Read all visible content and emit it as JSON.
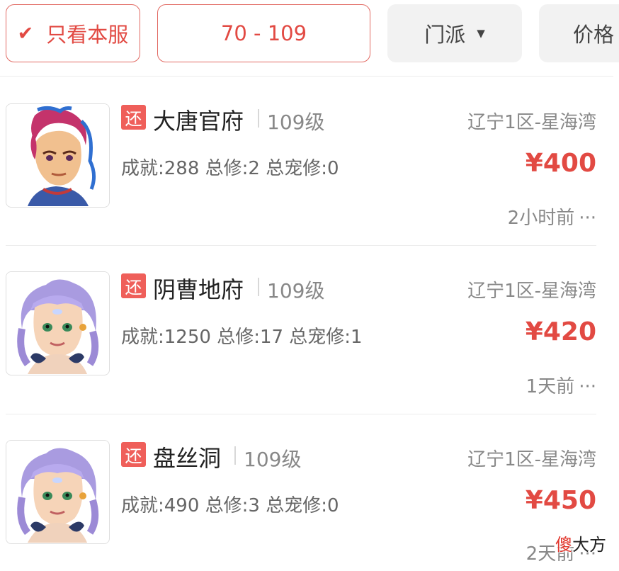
{
  "filters": {
    "server_only": {
      "check_icon": "checkmark-icon",
      "label": "只看本服"
    },
    "level_range": "70 - 109",
    "sect": {
      "label": "门派",
      "icon": "caret-down-icon"
    },
    "price": "价格"
  },
  "listings": [
    {
      "badge": "还",
      "sect": "大唐官府",
      "level": "109级",
      "server": "辽宁1区-星海湾",
      "stats": "成就:288 总修:2 总宠修:0",
      "price": "¥400",
      "time": "2小时前",
      "more": "···",
      "avatar": "warrior-avatar"
    },
    {
      "badge": "还",
      "sect": "阴曹地府",
      "level": "109级",
      "server": "辽宁1区-星海湾",
      "stats": "成就:1250 总修:17 总宠修:1",
      "price": "¥420",
      "time": "1天前",
      "more": "···",
      "avatar": "purple-hair-avatar"
    },
    {
      "badge": "还",
      "sect": "盘丝洞",
      "level": "109级",
      "server": "辽宁1区-星海湾",
      "stats": "成就:490 总修:3 总宠修:0",
      "price": "¥450",
      "time": "2天前",
      "more": "···",
      "avatar": "purple-hair-avatar"
    }
  ],
  "watermark": {
    "red": "傻",
    "rest": "大方"
  },
  "colors": {
    "accent": "#e24a43",
    "badge": "#ef5f5a",
    "chip_bg": "#f2f2f2"
  }
}
